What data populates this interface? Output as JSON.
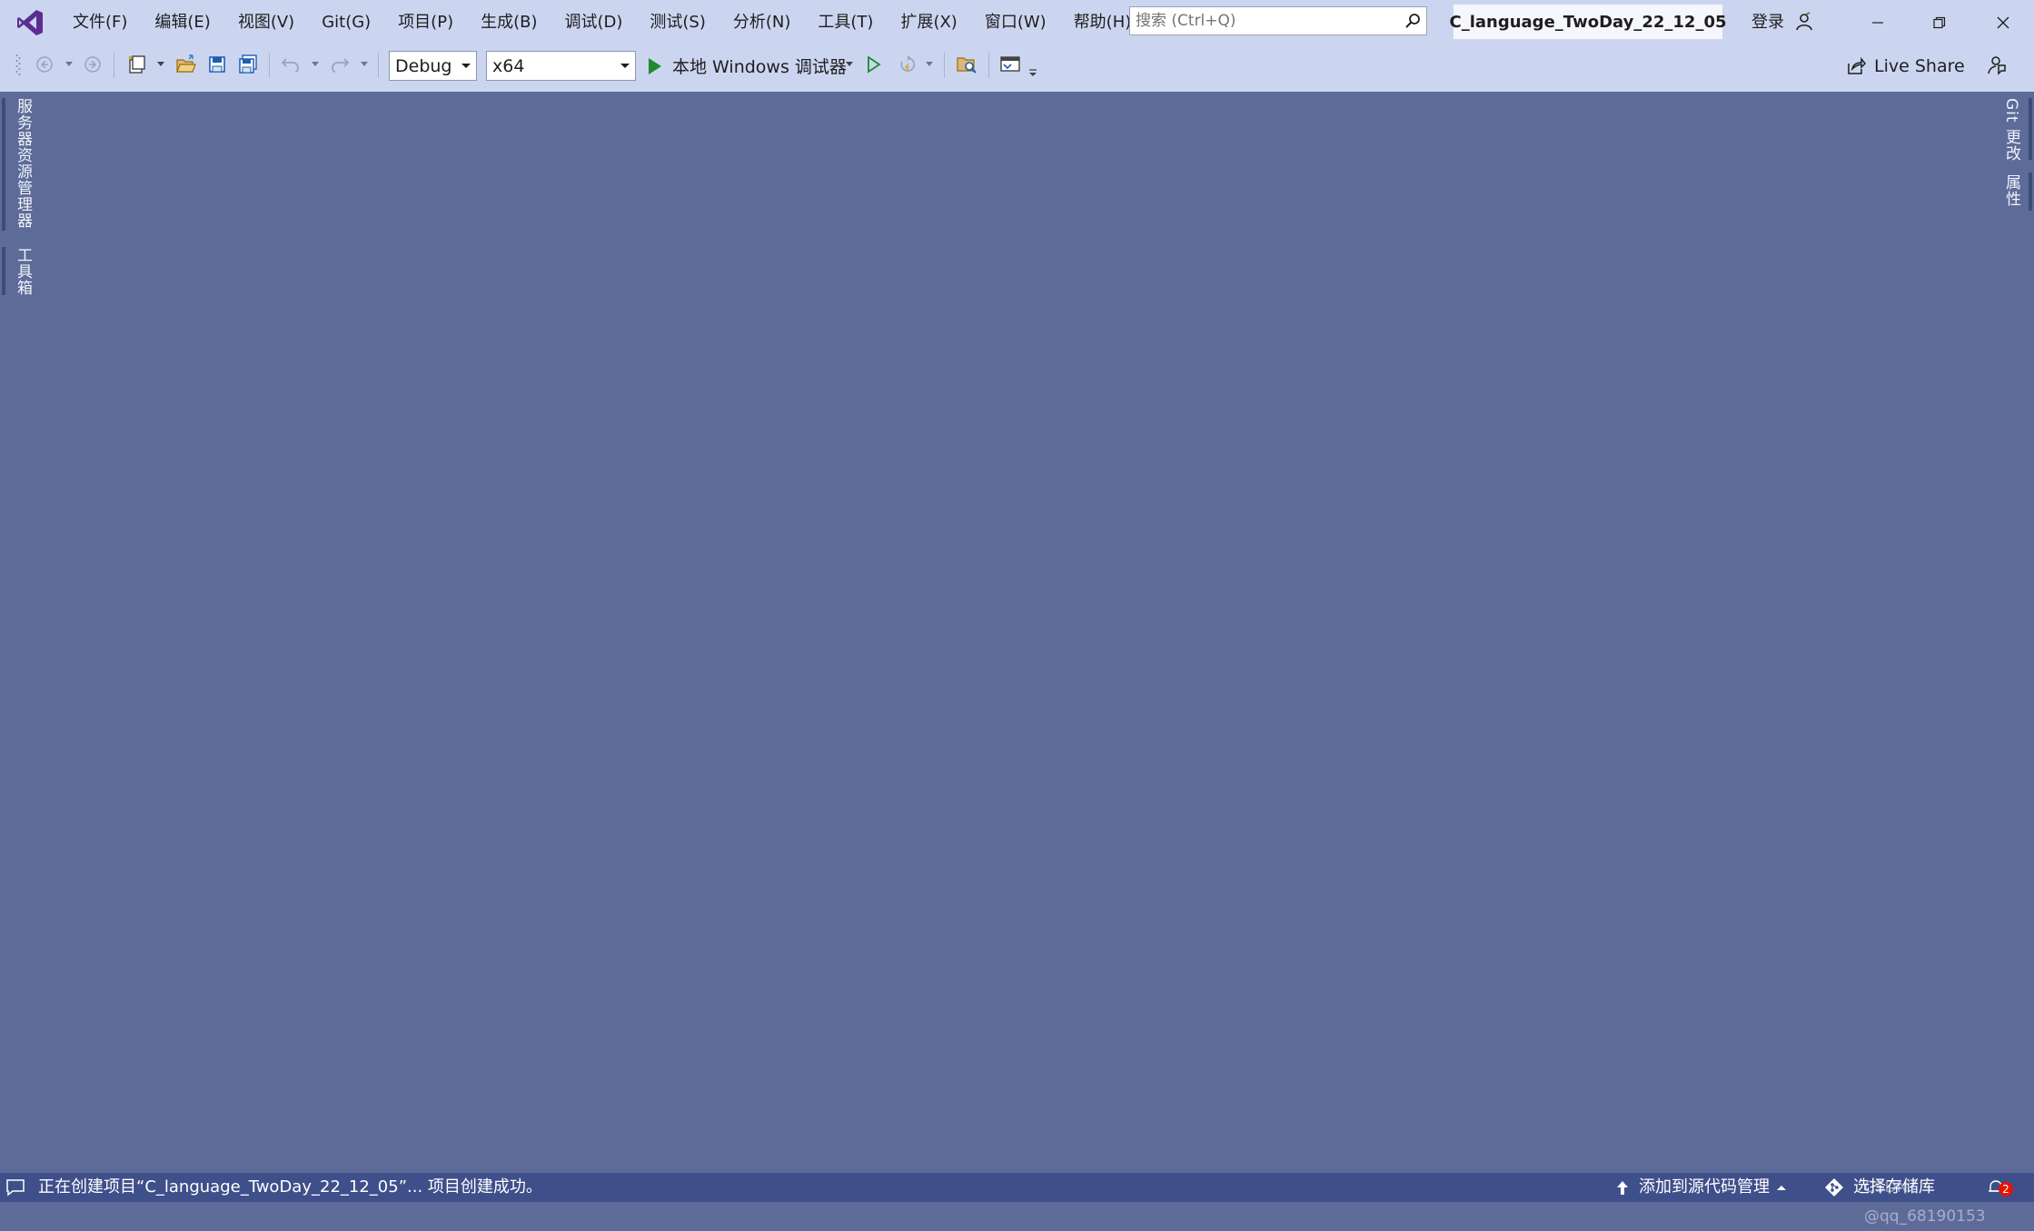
{
  "titlebar": {
    "menu": [
      "文件(F)",
      "编辑(E)",
      "视图(V)",
      "Git(G)",
      "项目(P)",
      "生成(B)",
      "调试(D)",
      "测试(S)",
      "分析(N)",
      "工具(T)",
      "扩展(X)",
      "窗口(W)",
      "帮助(H)"
    ],
    "search_placeholder": "搜索 (Ctrl+Q)",
    "solution_name": "C_language_TwoDay_22_12_05",
    "sign_in": "登录"
  },
  "toolbar": {
    "configuration": "Debug",
    "platform": "x64",
    "run_label": "本地 Windows 调试器",
    "live_share": "Live Share"
  },
  "left_tabs": [
    "服务器资源管理器",
    "工具箱"
  ],
  "right_tabs": [
    "Git 更改",
    "属性"
  ],
  "statusbar": {
    "message": "正在创建项目“C_language_TwoDay_22_12_05”... 项目创建成功。",
    "add_to_source_control": "添加到源代码管理",
    "select_repository": "选择存储库",
    "watermark": "CSDN @qq_68190153",
    "notification_count": "2"
  },
  "colors": {
    "chrome": "#ccd5f0",
    "workspace": "#5d6b99",
    "statusbar": "#3f4f8a",
    "run_green": "#1e8a2e"
  }
}
